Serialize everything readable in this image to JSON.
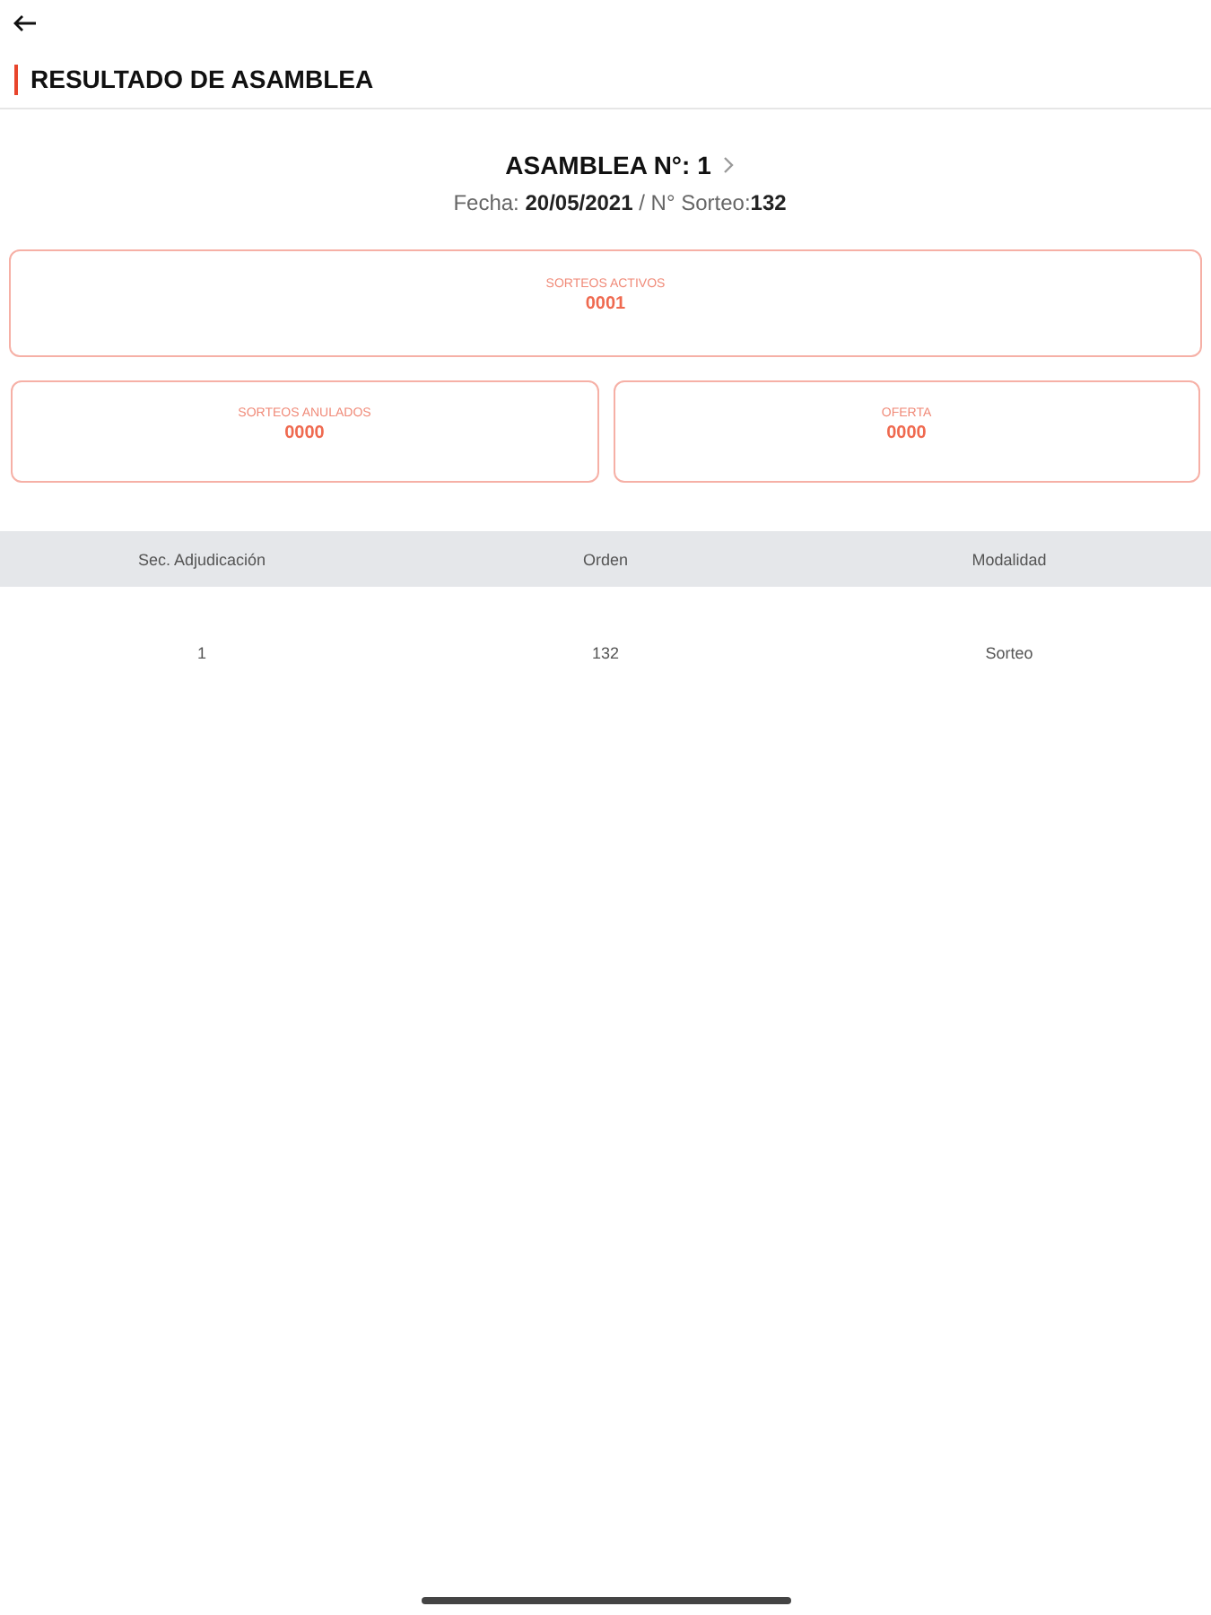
{
  "header": {
    "title": "RESULTADO DE ASAMBLEA"
  },
  "assembly": {
    "title": "ASAMBLEA N°: 1",
    "subtitle": "Fecha: **20/05/2021** / N° Sorteo:**132**"
  },
  "stats": [
    {
      "label": "SORTEOS ACTIVOS",
      "value": "0001",
      "wide": true
    },
    {
      "label": "SORTEOS ANULADOS",
      "value": "0000",
      "wide": false
    },
    {
      "label": "OFERTA",
      "value": "0000",
      "wide": false
    }
  ],
  "table": {
    "columns": [
      "Sec. Adjudicación",
      "Orden",
      "Modalidad"
    ],
    "rows": [
      [
        "1",
        "132",
        "Sorteo"
      ]
    ]
  }
}
